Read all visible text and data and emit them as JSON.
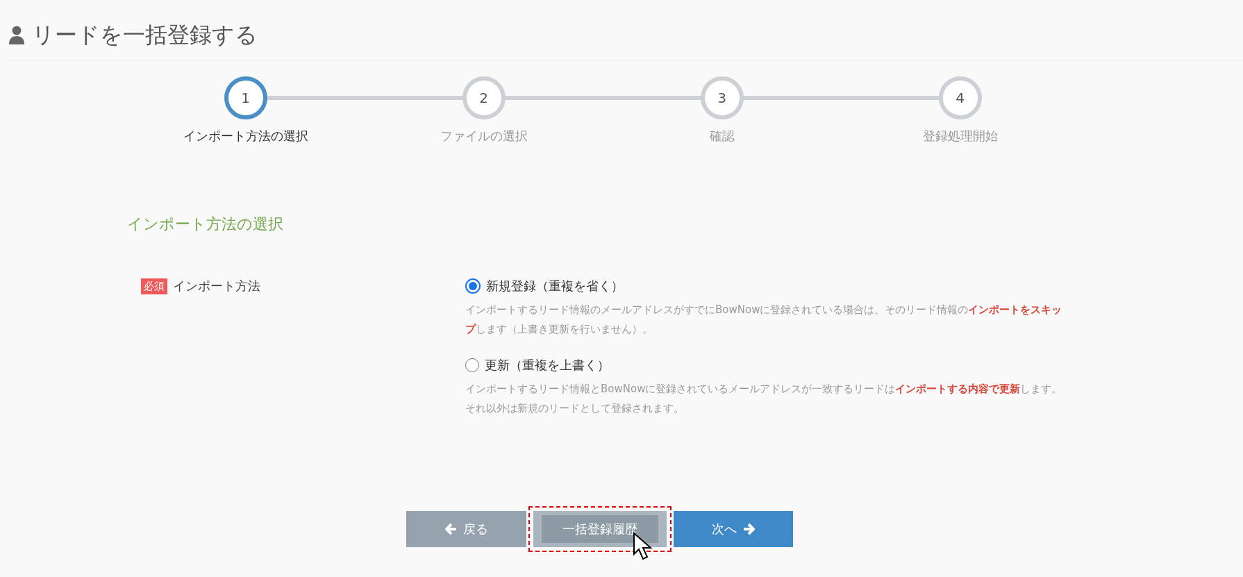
{
  "page_title": "リードを一括登録する",
  "steps": [
    {
      "number": "1",
      "label": "インポート方法の選択",
      "selected": true
    },
    {
      "number": "2",
      "label": "ファイルの選択",
      "selected": false
    },
    {
      "number": "3",
      "label": "確認",
      "selected": false
    },
    {
      "number": "4",
      "label": "登録処理開始",
      "selected": false
    }
  ],
  "section_title": "インポート方法の選択",
  "field": {
    "required_badge": "必須",
    "label": "インポート方法",
    "options": [
      {
        "label": "新規登録（重複を省く）",
        "selected": true,
        "description": "インポートするリード情報のメールアドレスがすでにBowNowに登録されている場合は、そのリード情報の**インポートをスキップ**します（上書き更新を行いません）。"
      },
      {
        "label": "更新（重複を上書く）",
        "selected": false,
        "description": "インポートするリード情報とBowNowに登録されているメールアドレスが一致するリードは**インポートする内容で更新**します。それ以外は新規のリードとして登録されます。"
      }
    ]
  },
  "buttons": [
    {
      "kind": "back",
      "label": "戻る",
      "highlighted": false
    },
    {
      "kind": "history",
      "label": "一括登録履歴",
      "highlighted": true
    },
    {
      "kind": "next",
      "label": "次へ",
      "highlighted": false
    }
  ]
}
